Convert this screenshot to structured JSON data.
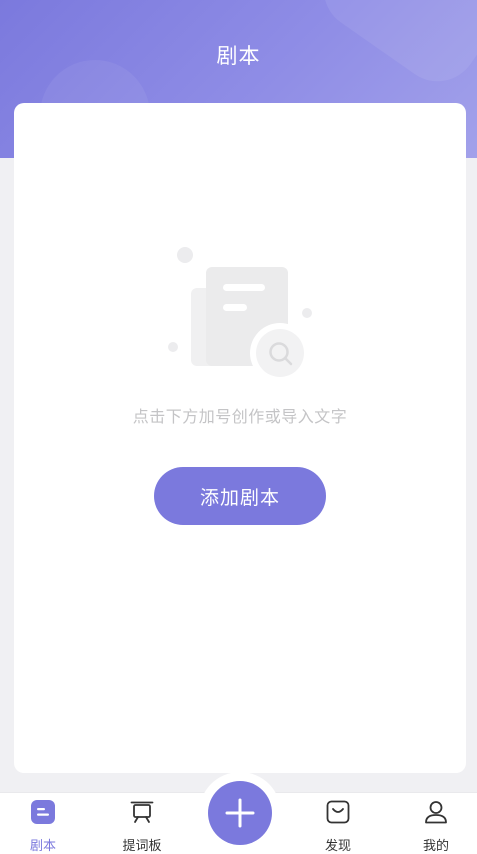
{
  "header": {
    "title": "剧本"
  },
  "empty_state": {
    "message": "点击下方加号创作或导入文字",
    "add_button_label": "添加剧本"
  },
  "tabbar": {
    "tabs": [
      {
        "label": "剧本",
        "icon": "script-icon",
        "active": true
      },
      {
        "label": "提词板",
        "icon": "teleprompter-icon",
        "active": false
      },
      {
        "label": "发现",
        "icon": "discover-bag-icon",
        "active": false
      },
      {
        "label": "我的",
        "icon": "profile-icon",
        "active": false
      }
    ],
    "center_button_icon": "plus-icon"
  },
  "colors": {
    "accent": "#7b79dd",
    "background": "#f0f0f3",
    "muted_text": "#c4c4c6",
    "tab_text": "#333333"
  }
}
